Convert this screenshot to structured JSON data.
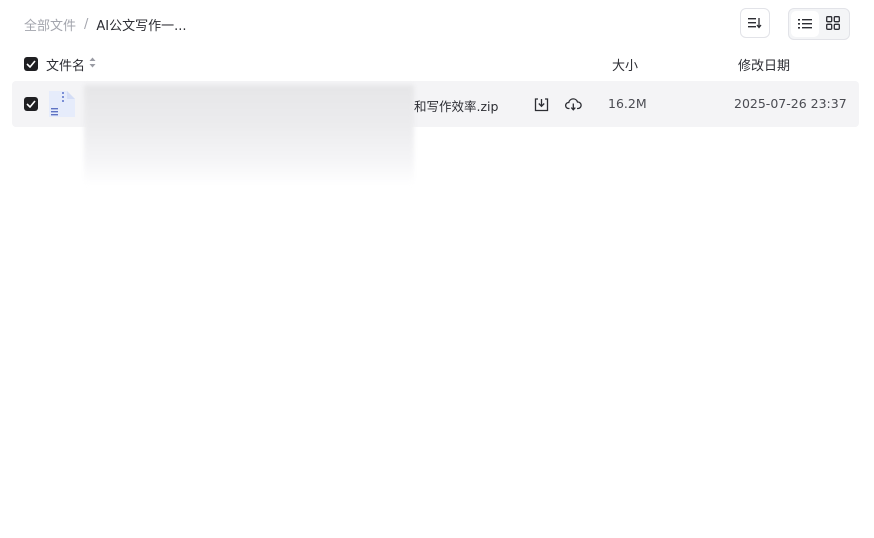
{
  "breadcrumb": {
    "root": "全部文件",
    "separator": "/",
    "current": "AI公文写作一..."
  },
  "toolbar": {
    "sort_icon": "sort-icon",
    "list_view_icon": "list-view-icon",
    "grid_view_icon": "grid-view-icon",
    "active_view": "list"
  },
  "table": {
    "header": {
      "name": "文件名",
      "size": "大小",
      "date": "修改日期"
    },
    "rows": [
      {
        "selected": true,
        "name_visible": "和写作效率.zip",
        "size": "16.2M",
        "modified": "2025-07-26 23:37",
        "icons": [
          "download-icon",
          "cloud-save-icon"
        ]
      }
    ]
  },
  "colors": {
    "checkbox": "#1f1f22",
    "row_background": "#f4f4f6",
    "muted_text": "#a3a5ad"
  }
}
